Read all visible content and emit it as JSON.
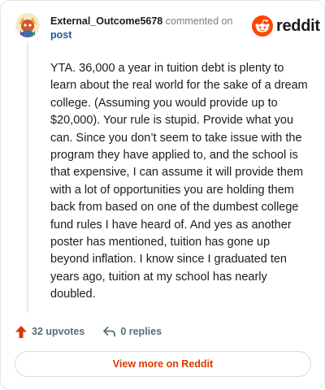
{
  "header": {
    "username": "External_Outcome5678",
    "commented_on": "commented on",
    "post_link": "post"
  },
  "brand": {
    "wordmark": "reddit",
    "icon": "reddit-logo-icon",
    "color": "#ff4500"
  },
  "comment": {
    "text": "YTA. 36,000 a year in tuition debt is plenty to learn about the real world for the sake of a dream college. (Assuming you would provide up to $20,000). Your rule is stupid. Provide what you can. Since you don’t seem to take issue with the program they have applied to, and the school is that expensive, I can assume it will provide them with a lot of opportunities you are holding them back from based on one of the dumbest college fund rules I have heard of. And yes as another poster has mentioned, tuition has gone up beyond inflation. I know since I graduated ten years ago, tuition at my school has nearly doubled."
  },
  "actions": {
    "upvotes": "32 upvotes",
    "replies": "0 replies",
    "upvote_icon": "upvote-arrow-icon",
    "reply_icon": "reply-arrow-icon",
    "upvote_color": "#d93a00"
  },
  "footer": {
    "view_more": "View more on Reddit",
    "accent": "#d93a00"
  }
}
